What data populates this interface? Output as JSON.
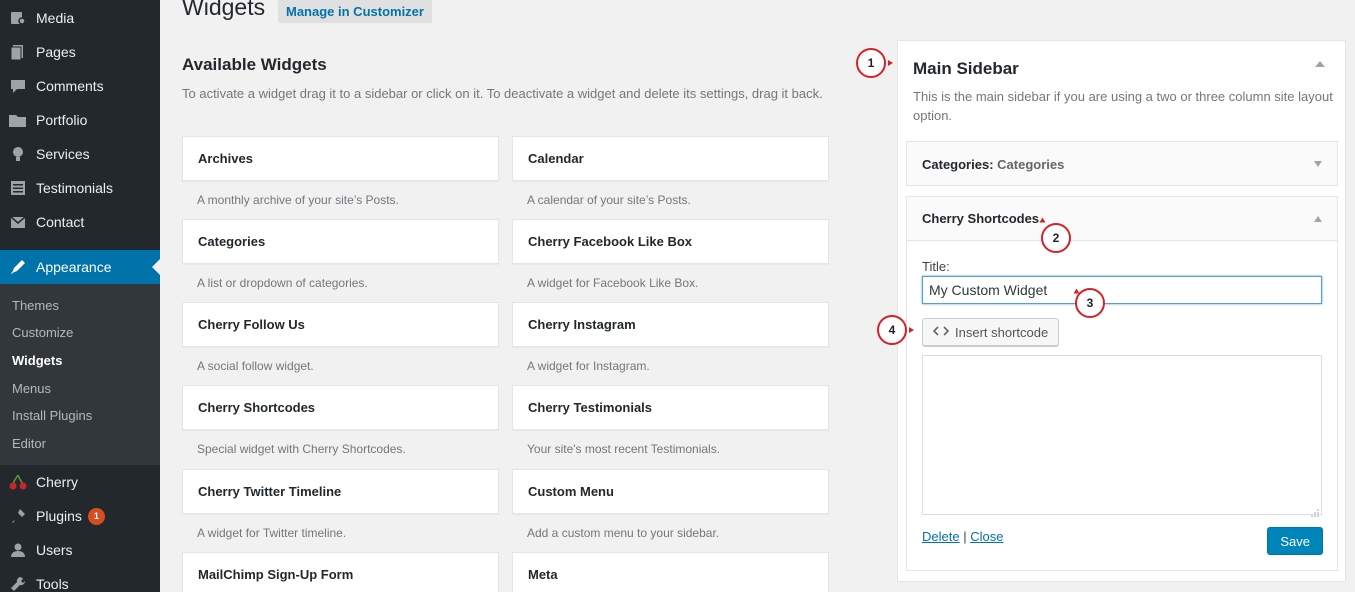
{
  "admin_menu": {
    "items": [
      {
        "label": "Media",
        "icon": "media-icon"
      },
      {
        "label": "Pages",
        "icon": "pages-icon"
      },
      {
        "label": "Comments",
        "icon": "comments-icon"
      },
      {
        "label": "Portfolio",
        "icon": "portfolio-icon"
      },
      {
        "label": "Services",
        "icon": "services-icon"
      },
      {
        "label": "Testimonials",
        "icon": "testimonials-icon"
      },
      {
        "label": "Contact",
        "icon": "contact-icon"
      },
      {
        "label": "Appearance",
        "icon": "appearance-icon"
      },
      {
        "label": "Cherry",
        "icon": "cherry-icon"
      },
      {
        "label": "Plugins",
        "icon": "plugins-icon",
        "badge": "1"
      },
      {
        "label": "Users",
        "icon": "users-icon"
      },
      {
        "label": "Tools",
        "icon": "tools-icon"
      }
    ],
    "submenu": [
      "Themes",
      "Customize",
      "Widgets",
      "Menus",
      "Install Plugins",
      "Editor"
    ],
    "current_submenu": "Widgets"
  },
  "header": {
    "title": "Widgets",
    "manage_button": "Manage in Customizer"
  },
  "available": {
    "title": "Available Widgets",
    "description": "To activate a widget drag it to a sidebar or click on it. To deactivate a widget and delete its settings, drag it back.",
    "widgets": [
      {
        "name": "Archives",
        "desc": "A monthly archive of your site’s Posts."
      },
      {
        "name": "Calendar",
        "desc": "A calendar of your site’s Posts."
      },
      {
        "name": "Categories",
        "desc": "A list or dropdown of categories."
      },
      {
        "name": "Cherry Facebook Like Box",
        "desc": "A widget for Facebook Like Box."
      },
      {
        "name": "Cherry Follow Us",
        "desc": "A social follow widget."
      },
      {
        "name": "Cherry Instagram",
        "desc": "A widget for Instagram."
      },
      {
        "name": "Cherry Shortcodes",
        "desc": "Special widget with Cherry Shortcodes."
      },
      {
        "name": "Cherry Testimonials",
        "desc": "Your site's most recent Testimonials."
      },
      {
        "name": "Cherry Twitter Timeline",
        "desc": "A widget for Twitter timeline."
      },
      {
        "name": "Custom Menu",
        "desc": "Add a custom menu to your sidebar."
      },
      {
        "name": "MailChimp Sign-Up Form",
        "desc": ""
      },
      {
        "name": "Meta",
        "desc": ""
      }
    ]
  },
  "main_sidebar": {
    "title": "Main Sidebar",
    "description": "This is the main sidebar if you are using a two or three column site layout option.",
    "categories_widget": {
      "name": "Categories:",
      "title": "Categories"
    },
    "shortcodes_widget": {
      "name": "Cherry Shortcodes",
      "title_label": "Title:",
      "title_value": "My Custom Widget",
      "insert_button": "Insert shortcode",
      "delete_link": "Delete",
      "separator": "|",
      "close_link": "Close",
      "save_button": "Save"
    }
  },
  "callouts": [
    "1",
    "2",
    "3",
    "4"
  ],
  "colors": {
    "admin_bg": "#23282d",
    "submenu_bg": "#32373c",
    "accent": "#0073aa",
    "save_button": "#0085ba",
    "badge": "#d54e21",
    "callout_border": "#d62226"
  }
}
